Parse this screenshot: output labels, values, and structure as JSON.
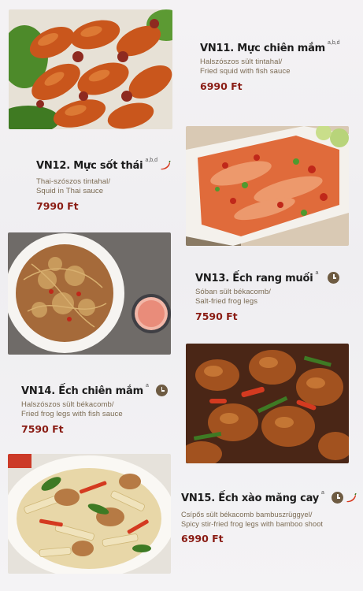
{
  "items": [
    {
      "code_name": "VN11. Mực chiên mắm",
      "allergens": "a,b,d",
      "hu": "Halszószos sült tintahal/",
      "en": "Fried squid with fish sauce",
      "price": "6990 Ft",
      "clock": "",
      "chili": ""
    },
    {
      "code_name": "VN12. Mực sốt thái",
      "allergens": "a,b,d",
      "hu": "Thai-szószos tintahal/",
      "en": "Squid in Thai sauce",
      "price": "7990 Ft",
      "clock": "",
      "chili": "chili-icon"
    },
    {
      "code_name": "VN13. Ếch rang muối",
      "allergens": "a",
      "hu": "Sóban sült békacomb/",
      "en": "Salt-fried frog legs",
      "price": "7590 Ft",
      "clock": "clock-icon",
      "chili": ""
    },
    {
      "code_name": "VN14. Ếch chiên mắm",
      "allergens": "a",
      "hu": "Halszószos sült békacomb/",
      "en": "Fried frog legs with fish sauce",
      "price": "7590 Ft",
      "clock": "clock-icon",
      "chili": ""
    },
    {
      "code_name": "VN15. Ếch xào măng cay",
      "allergens": "a",
      "hu": "Csípős sült békacomb bambuszrüggyel/",
      "en": "Spicy stir-fried frog legs with bamboo shoot",
      "price": "6990 Ft",
      "clock": "clock-icon",
      "chili": "chili-icon"
    }
  ],
  "colors": {
    "price": "#8a1c14",
    "description": "#7a6a52",
    "clock": "#6e5b42",
    "chili": "#d83a1f"
  }
}
